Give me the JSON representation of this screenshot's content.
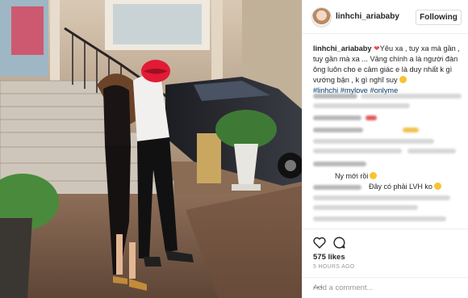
{
  "post": {
    "username": "linhchi_ariababy",
    "follow_label": "Following",
    "caption_user": "linhchi_ariababy",
    "caption_text": "Yêu xa , tuy xa mà gần , tuy gần mà xa ... Vâng chính a là người đàn ông luôn cho e cảm giác e là duy nhất k gì vướng bận , k gì nghĩ suy",
    "hashtags": "#linhchi #mylove #onlyme",
    "comments": [
      {
        "text": "Ny mới rồi"
      },
      {
        "text": "Đây có phải LVH ko"
      }
    ],
    "likes": "575 likes",
    "time": "5 HOURS AGO",
    "add_comment_placeholder": "Add a comment...",
    "more_label": "•••",
    "heart_symbol": "❤"
  },
  "icons": {
    "like": "heart-outline-icon",
    "comment": "speech-bubble-icon",
    "more": "ellipsis-icon"
  },
  "colors": {
    "heart": "#ed4956",
    "hashtag": "#003569",
    "muted": "#999999",
    "border": "#efefef"
  }
}
